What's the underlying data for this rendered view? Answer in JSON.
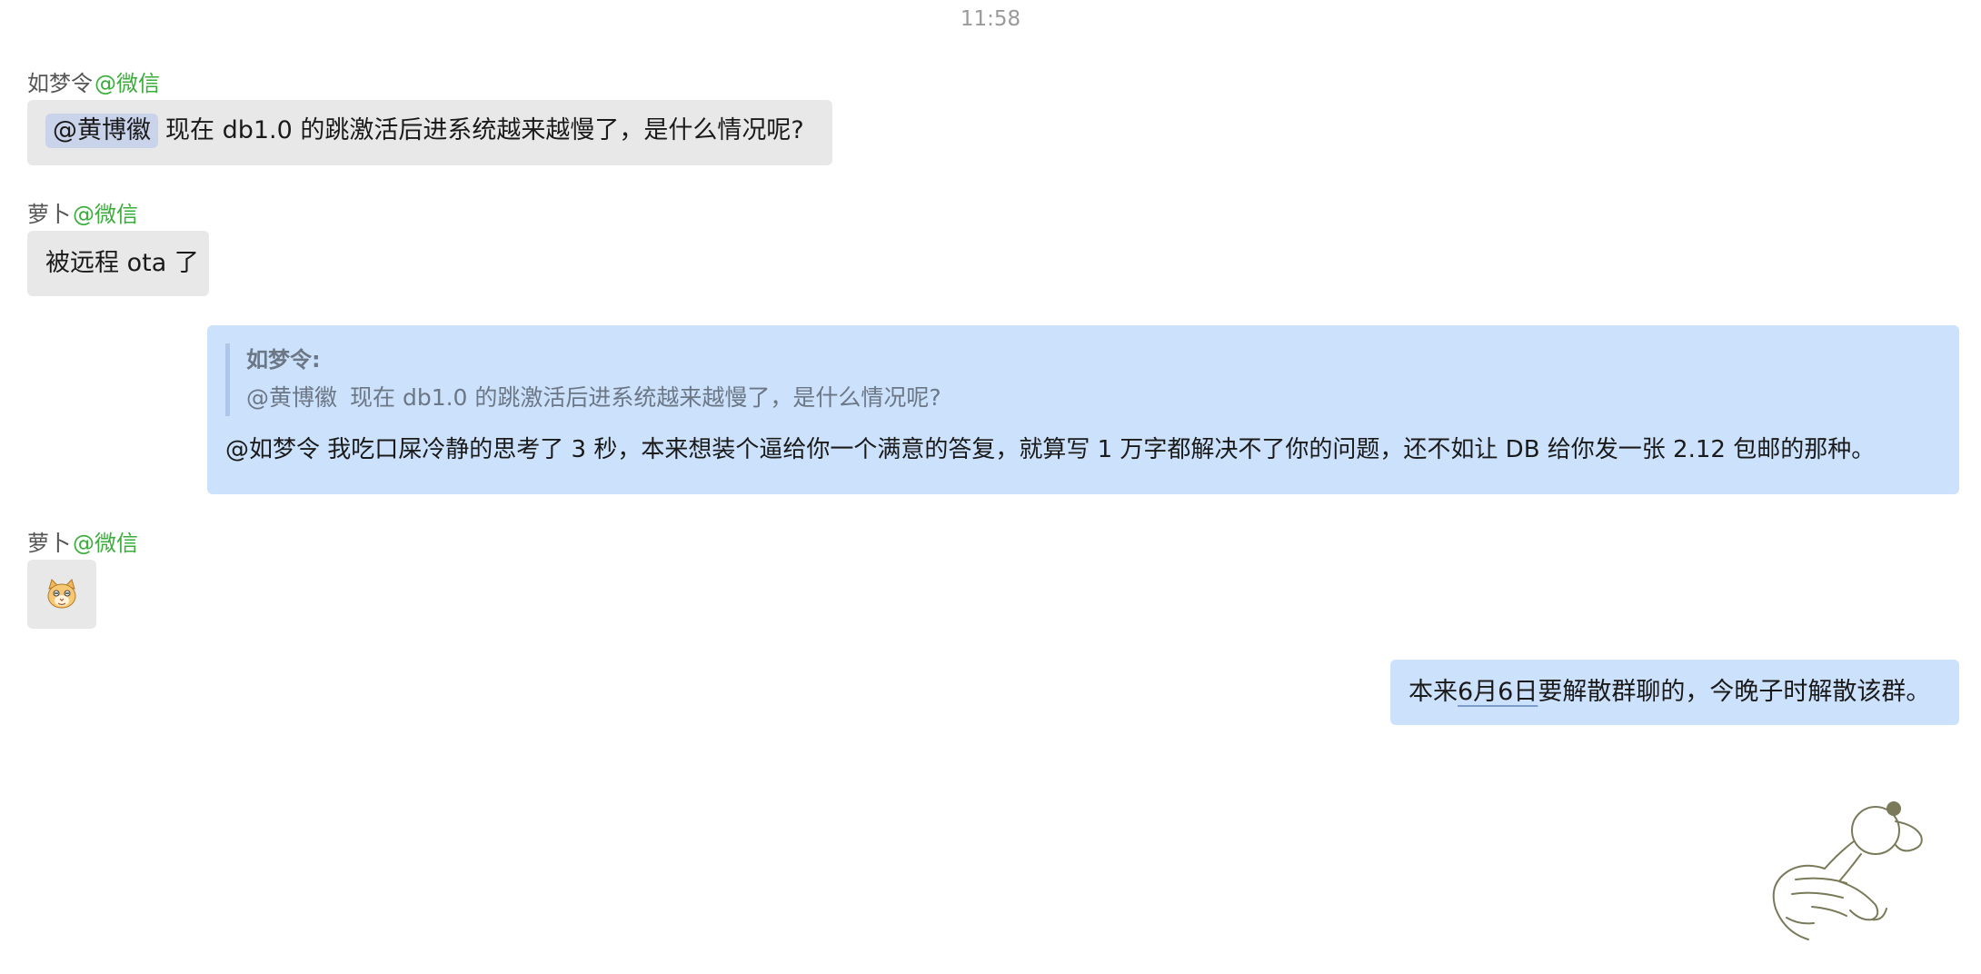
{
  "timestamp": "11:58",
  "messages": [
    {
      "sender": "如梦令",
      "platform": "@微信",
      "mention": "@黄博徽",
      "text": "现在 db1.0 的跳激活后进系统越来越慢了，是什么情况呢?"
    },
    {
      "sender": "萝卜",
      "platform": "@微信",
      "text": "被远程 ota 了"
    },
    {
      "quote_author": "如梦令:",
      "quote_mention": "@黄博徽",
      "quote_text": "现在 db1.0 的跳激活后进系统越来越慢了，是什么情况呢?",
      "text": "@如梦令 我吃口屎冷静的思考了 3 秒，本来想装个逼给你一个满意的答复，就算写 1 万字都解决不了你的问题，还不如让 DB 给你发一张 2.12 包邮的那种。"
    },
    {
      "sender": "萝卜",
      "platform": "@微信",
      "sticker": "cat-face-emoji"
    },
    {
      "text_before": "本来",
      "date_link": "6月6日",
      "text_after": "要解散群聊的，今晚子时解散该群。"
    }
  ],
  "colors": {
    "incoming_bubble": "#e8e8e8",
    "outgoing_bubble": "#cce1fb",
    "platform_green": "#3aae3a",
    "mention_bg": "#c9d3ea"
  },
  "decoration": "bear-mascot-sketch"
}
